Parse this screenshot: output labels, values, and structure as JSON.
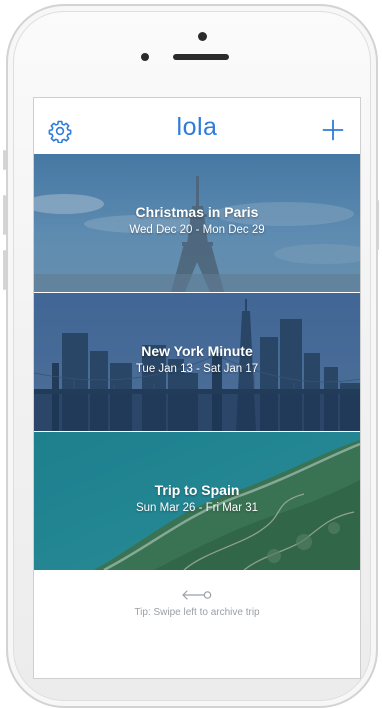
{
  "app": {
    "title": "lola"
  },
  "navbar": {
    "settings_icon": "gear-icon",
    "add_icon": "plus-icon",
    "accent_color": "#2e7bd8"
  },
  "trips": [
    {
      "name": "Christmas in Paris",
      "dates": "Wed Dec 20 - Mon Dec 29",
      "image": "eiffel-tower-photo"
    },
    {
      "name": "New York Minute",
      "dates": "Tue Jan 13 - Sat Jan 17",
      "image": "new-york-skyline-photo"
    },
    {
      "name": "Trip to Spain",
      "dates": "Sun Mar 26 - Fri Mar 31",
      "image": "spain-coastline-photo"
    }
  ],
  "tip": {
    "icon": "swipe-left-arrow-icon",
    "text": "Tip: Swipe left to archive trip"
  }
}
